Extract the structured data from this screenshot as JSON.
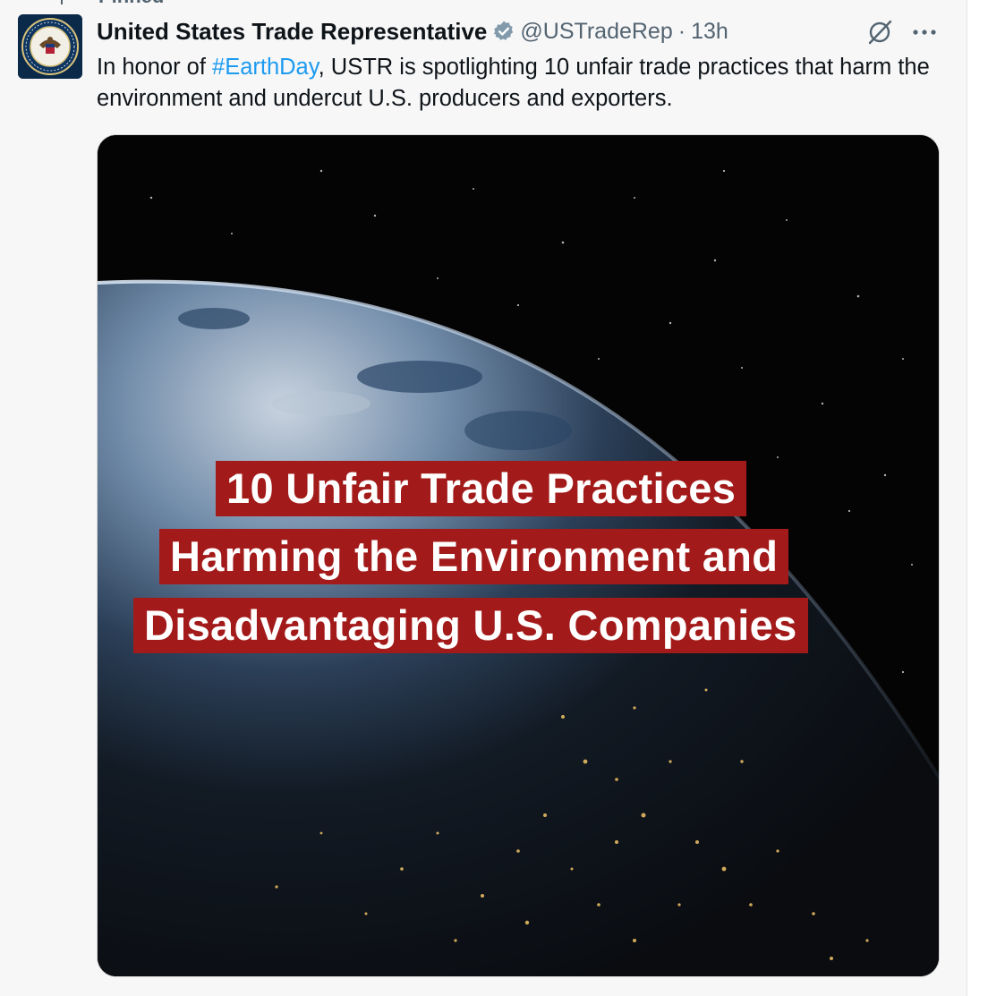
{
  "pinned": {
    "label": "Pinned"
  },
  "tweet": {
    "author": {
      "display_name": "United States Trade Representative",
      "handle": "@USTradeRep",
      "verified": true
    },
    "separator": "·",
    "time": "13h",
    "text": {
      "before_hashtag": "In honor of ",
      "hashtag": "#EarthDay",
      "after_hashtag": ", USTR is spotlighting 10 unfair trade practices that harm the environment and undercut U.S. producers and exporters."
    },
    "media": {
      "lines": [
        "10 Unfair Trade Practices",
        "Harming the Environment and",
        "Disadvantaging U.S. Companies"
      ]
    }
  },
  "icons": {
    "pin": "pin-icon",
    "verified": "verified-badge-icon",
    "grok": "grok-icon",
    "more": "more-icon"
  },
  "colors": {
    "link": "#1d9bf0",
    "banner": "#a31a1a",
    "secondary_text": "#536471"
  }
}
